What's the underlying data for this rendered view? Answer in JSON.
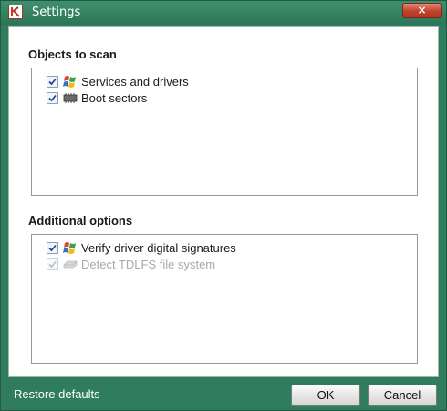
{
  "window": {
    "title": "Settings",
    "close_label": "×"
  },
  "objects_section": {
    "title": "Objects to scan",
    "items": [
      {
        "label": "Services and drivers",
        "checked": true,
        "enabled": true,
        "icon": "windows-flag-icon"
      },
      {
        "label": "Boot sectors",
        "checked": true,
        "enabled": true,
        "icon": "chip-icon"
      }
    ]
  },
  "additional_section": {
    "title": "Additional options",
    "items": [
      {
        "label": "Verify driver digital signatures",
        "checked": true,
        "enabled": true,
        "icon": "windows-flag-icon"
      },
      {
        "label": "Detect TDLFS file system",
        "checked": true,
        "enabled": false,
        "icon": "disk-icon"
      }
    ]
  },
  "footer": {
    "restore_label": "Restore defaults",
    "ok_label": "OK",
    "cancel_label": "Cancel"
  },
  "colors": {
    "frame": "#2f7d5e",
    "close_button": "#c1412b",
    "disabled_text": "#a8a8a8"
  }
}
